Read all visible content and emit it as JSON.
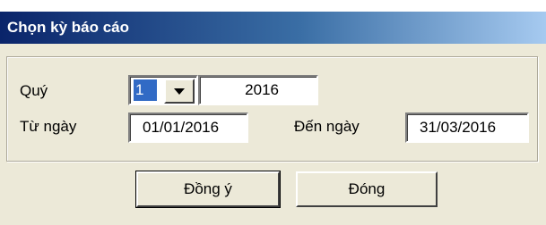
{
  "window": {
    "title": "Chọn kỳ báo cáo"
  },
  "form": {
    "quarter_label": "Quý",
    "quarter_value": "1",
    "year_value": "2016",
    "from_date_label": "Từ ngày",
    "from_date_value": "01/01/2016",
    "to_date_label": "Đến ngày",
    "to_date_value": "31/03/2016"
  },
  "buttons": {
    "ok_label": "Đồng ý",
    "close_label": "Đóng"
  },
  "colors": {
    "title_start": "#0a246a",
    "title_end": "#a6caf0",
    "dialog_bg": "#ece9d8",
    "selection": "#316ac5"
  },
  "icons": {
    "dropdown": "chevron-down-icon"
  }
}
